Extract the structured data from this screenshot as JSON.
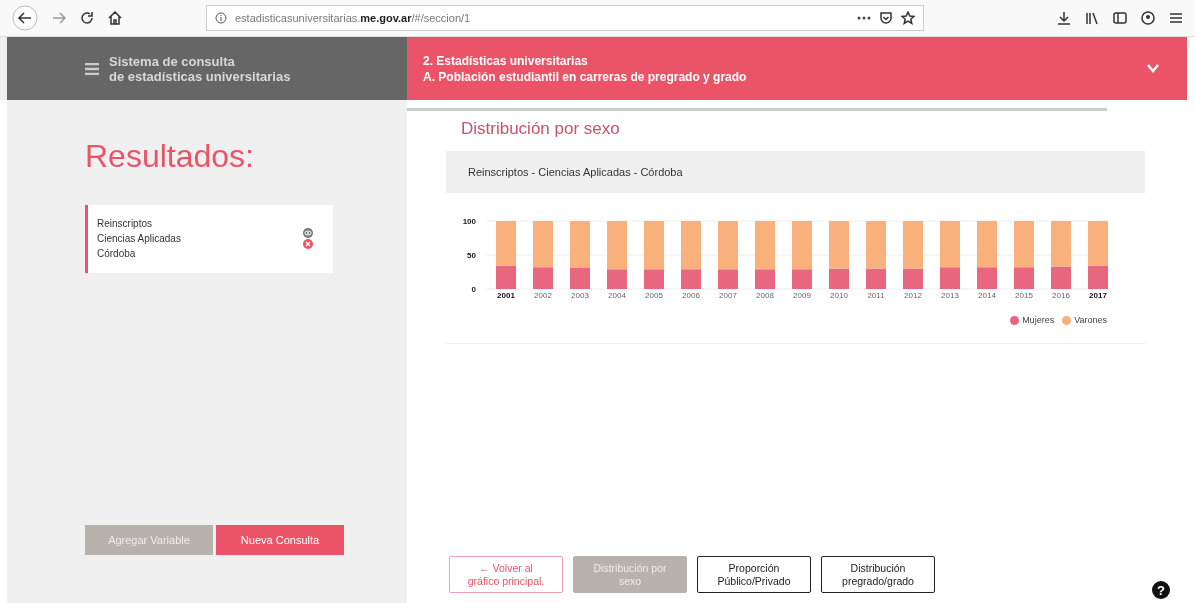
{
  "browser": {
    "url_host": "estadisticasuniversitarias.",
    "url_domain": "me.gov.ar",
    "url_path": "/#/seccion/1"
  },
  "header": {
    "app_title_line1": "Sistema de consulta",
    "app_title_line2": "de estadísticas universitarias",
    "section_line1": "2. Estadísticas universitarias",
    "section_line2": "A. Población estudiantil en carreras de pregrado y grado"
  },
  "sidebar": {
    "title": "Resultados:",
    "results": [
      {
        "lines": [
          "Reinscriptos",
          "Ciencias Aplicadas",
          "Córdoba"
        ]
      }
    ],
    "buttons": [
      {
        "label": "Agregar Variable",
        "kind": "secondary"
      },
      {
        "label": "Nueva Consulta",
        "kind": "primary"
      }
    ]
  },
  "main": {
    "title": "Distribución por sexo",
    "card_title": "Reinscriptos - Ciencias Aplicadas - Córdoba",
    "chart_data": {
      "type": "bar",
      "stacked": true,
      "categories": [
        "2001",
        "2002",
        "2003",
        "2004",
        "2005",
        "2006",
        "2007",
        "2008",
        "2009",
        "2010",
        "2011",
        "2012",
        "2013",
        "2014",
        "2015",
        "2016",
        "2017"
      ],
      "ylim": [
        0,
        100
      ],
      "legend": true,
      "yticks": [
        0,
        50,
        100
      ],
      "series": [
        {
          "name": "Mujeres",
          "color": "#e8667f",
          "values": [
            34,
            32,
            31,
            29,
            29,
            29,
            29,
            29,
            29,
            30,
            30,
            30,
            32,
            32,
            32,
            33,
            34
          ]
        },
        {
          "name": "Varones",
          "color": "#f9b07a",
          "values": [
            66,
            68,
            69,
            71,
            71,
            71,
            71,
            71,
            71,
            70,
            70,
            70,
            68,
            68,
            68,
            67,
            66
          ]
        }
      ]
    },
    "buttons": [
      {
        "label": "← Volver al gráfico principal.",
        "kind": "back",
        "selected": false
      },
      {
        "label": "Distribución por sexo",
        "kind": "option",
        "selected": true
      },
      {
        "label": "Proporción Público/Privado",
        "kind": "option",
        "selected": false
      },
      {
        "label": "Distribución pregrado/grado",
        "kind": "option",
        "selected": false
      }
    ],
    "help_button": "?"
  }
}
